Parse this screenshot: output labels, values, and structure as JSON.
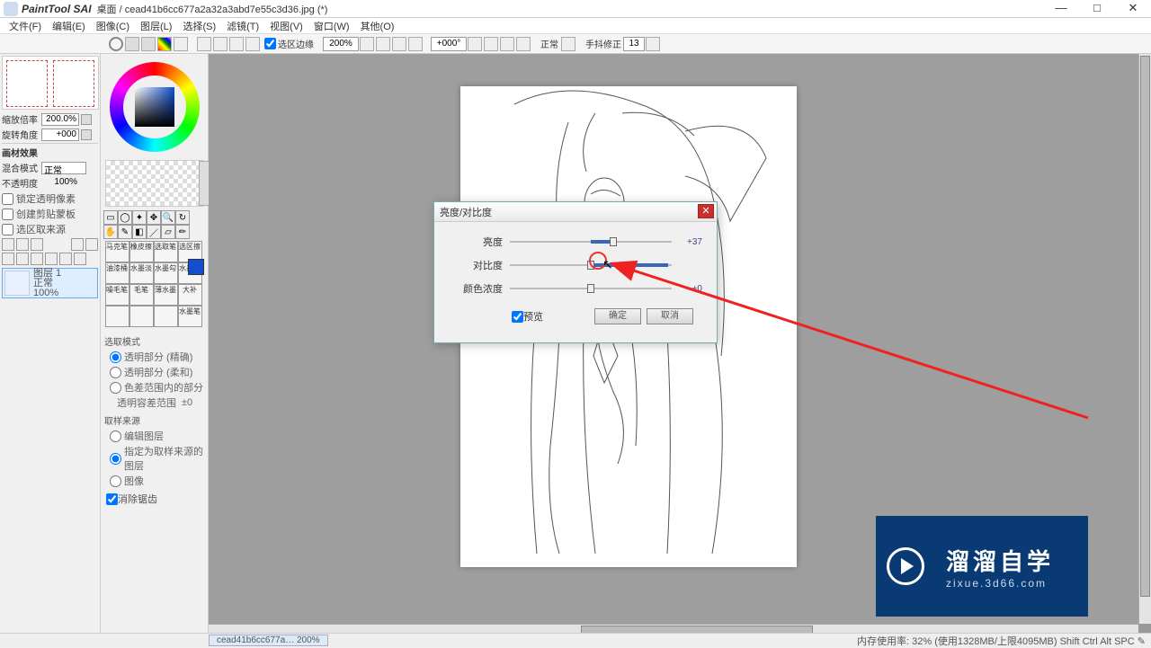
{
  "title": {
    "app": "PaintTool SAI",
    "doc": "桌面 / cead41b6cc677a2a32a3abd7e55c3d36.jpg (*)"
  },
  "menu": [
    "文件(F)",
    "编辑(E)",
    "图像(C)",
    "图层(L)",
    "选择(S)",
    "滤镜(T)",
    "视图(V)",
    "窗口(W)",
    "其他(O)"
  ],
  "toolbar": {
    "sel_edge_label": "选区边缘",
    "zoom": "200%",
    "angle": "+000°",
    "mode": "正常",
    "stabilizer_label": "手抖修正",
    "stabilizer": "13"
  },
  "left": {
    "scale_label": "缩放倍率",
    "scale": "200.0%",
    "rot_label": "旋转角度",
    "rot": "+000",
    "material_title": "画材效果",
    "blend_label": "混合模式",
    "blend": "正常",
    "opacity_label": "不透明度",
    "opacity": "100%",
    "chk1": "锁定透明像素",
    "chk2": "创建剪贴蒙板",
    "chk3": "选区取来源",
    "layer": {
      "name": "图层 1",
      "opacity": "正常\n100%"
    }
  },
  "brushes": [
    [
      "马克笔",
      "橡皮擦",
      "选取笔",
      "选区擦"
    ],
    [
      "油漆桶",
      "水墨淡",
      "水墨勾",
      "水墨线"
    ],
    [
      "噪毛笔",
      "毛笔",
      "薄水墨",
      "大补"
    ],
    [
      "",
      "",
      "",
      "水墨笔"
    ]
  ],
  "opts": {
    "sel_mode": "选取模式",
    "r1": "透明部分 (精确)",
    "r2": "透明部分 (柔和)",
    "r3": "色差范围内的部分",
    "range_label": "透明容差范围",
    "range_val": "±0",
    "samp": "取样来源",
    "s1": "编辑图层",
    "s2": "指定为取样来源的图层",
    "s3": "图像",
    "anti": "消除锯齿"
  },
  "dialog": {
    "title": "亮度/对比度",
    "rows": [
      {
        "label": "亮度",
        "value": "+37",
        "pos": 64
      },
      {
        "label": "对比度",
        "value": "",
        "pos": 50
      },
      {
        "label": "颜色浓度",
        "value": "±0",
        "pos": 50
      }
    ],
    "preview": "预览",
    "ok": "确定",
    "cancel": "取消"
  },
  "status": {
    "tab": "cead41b6cc677a… 200%",
    "mem": "内存使用率: 32% (使用1328MB/上限4095MB)  Shift Ctrl Alt SPC ✎"
  },
  "watermark": {
    "big": "溜溜自学",
    "small": "zixue.3d66.com"
  }
}
